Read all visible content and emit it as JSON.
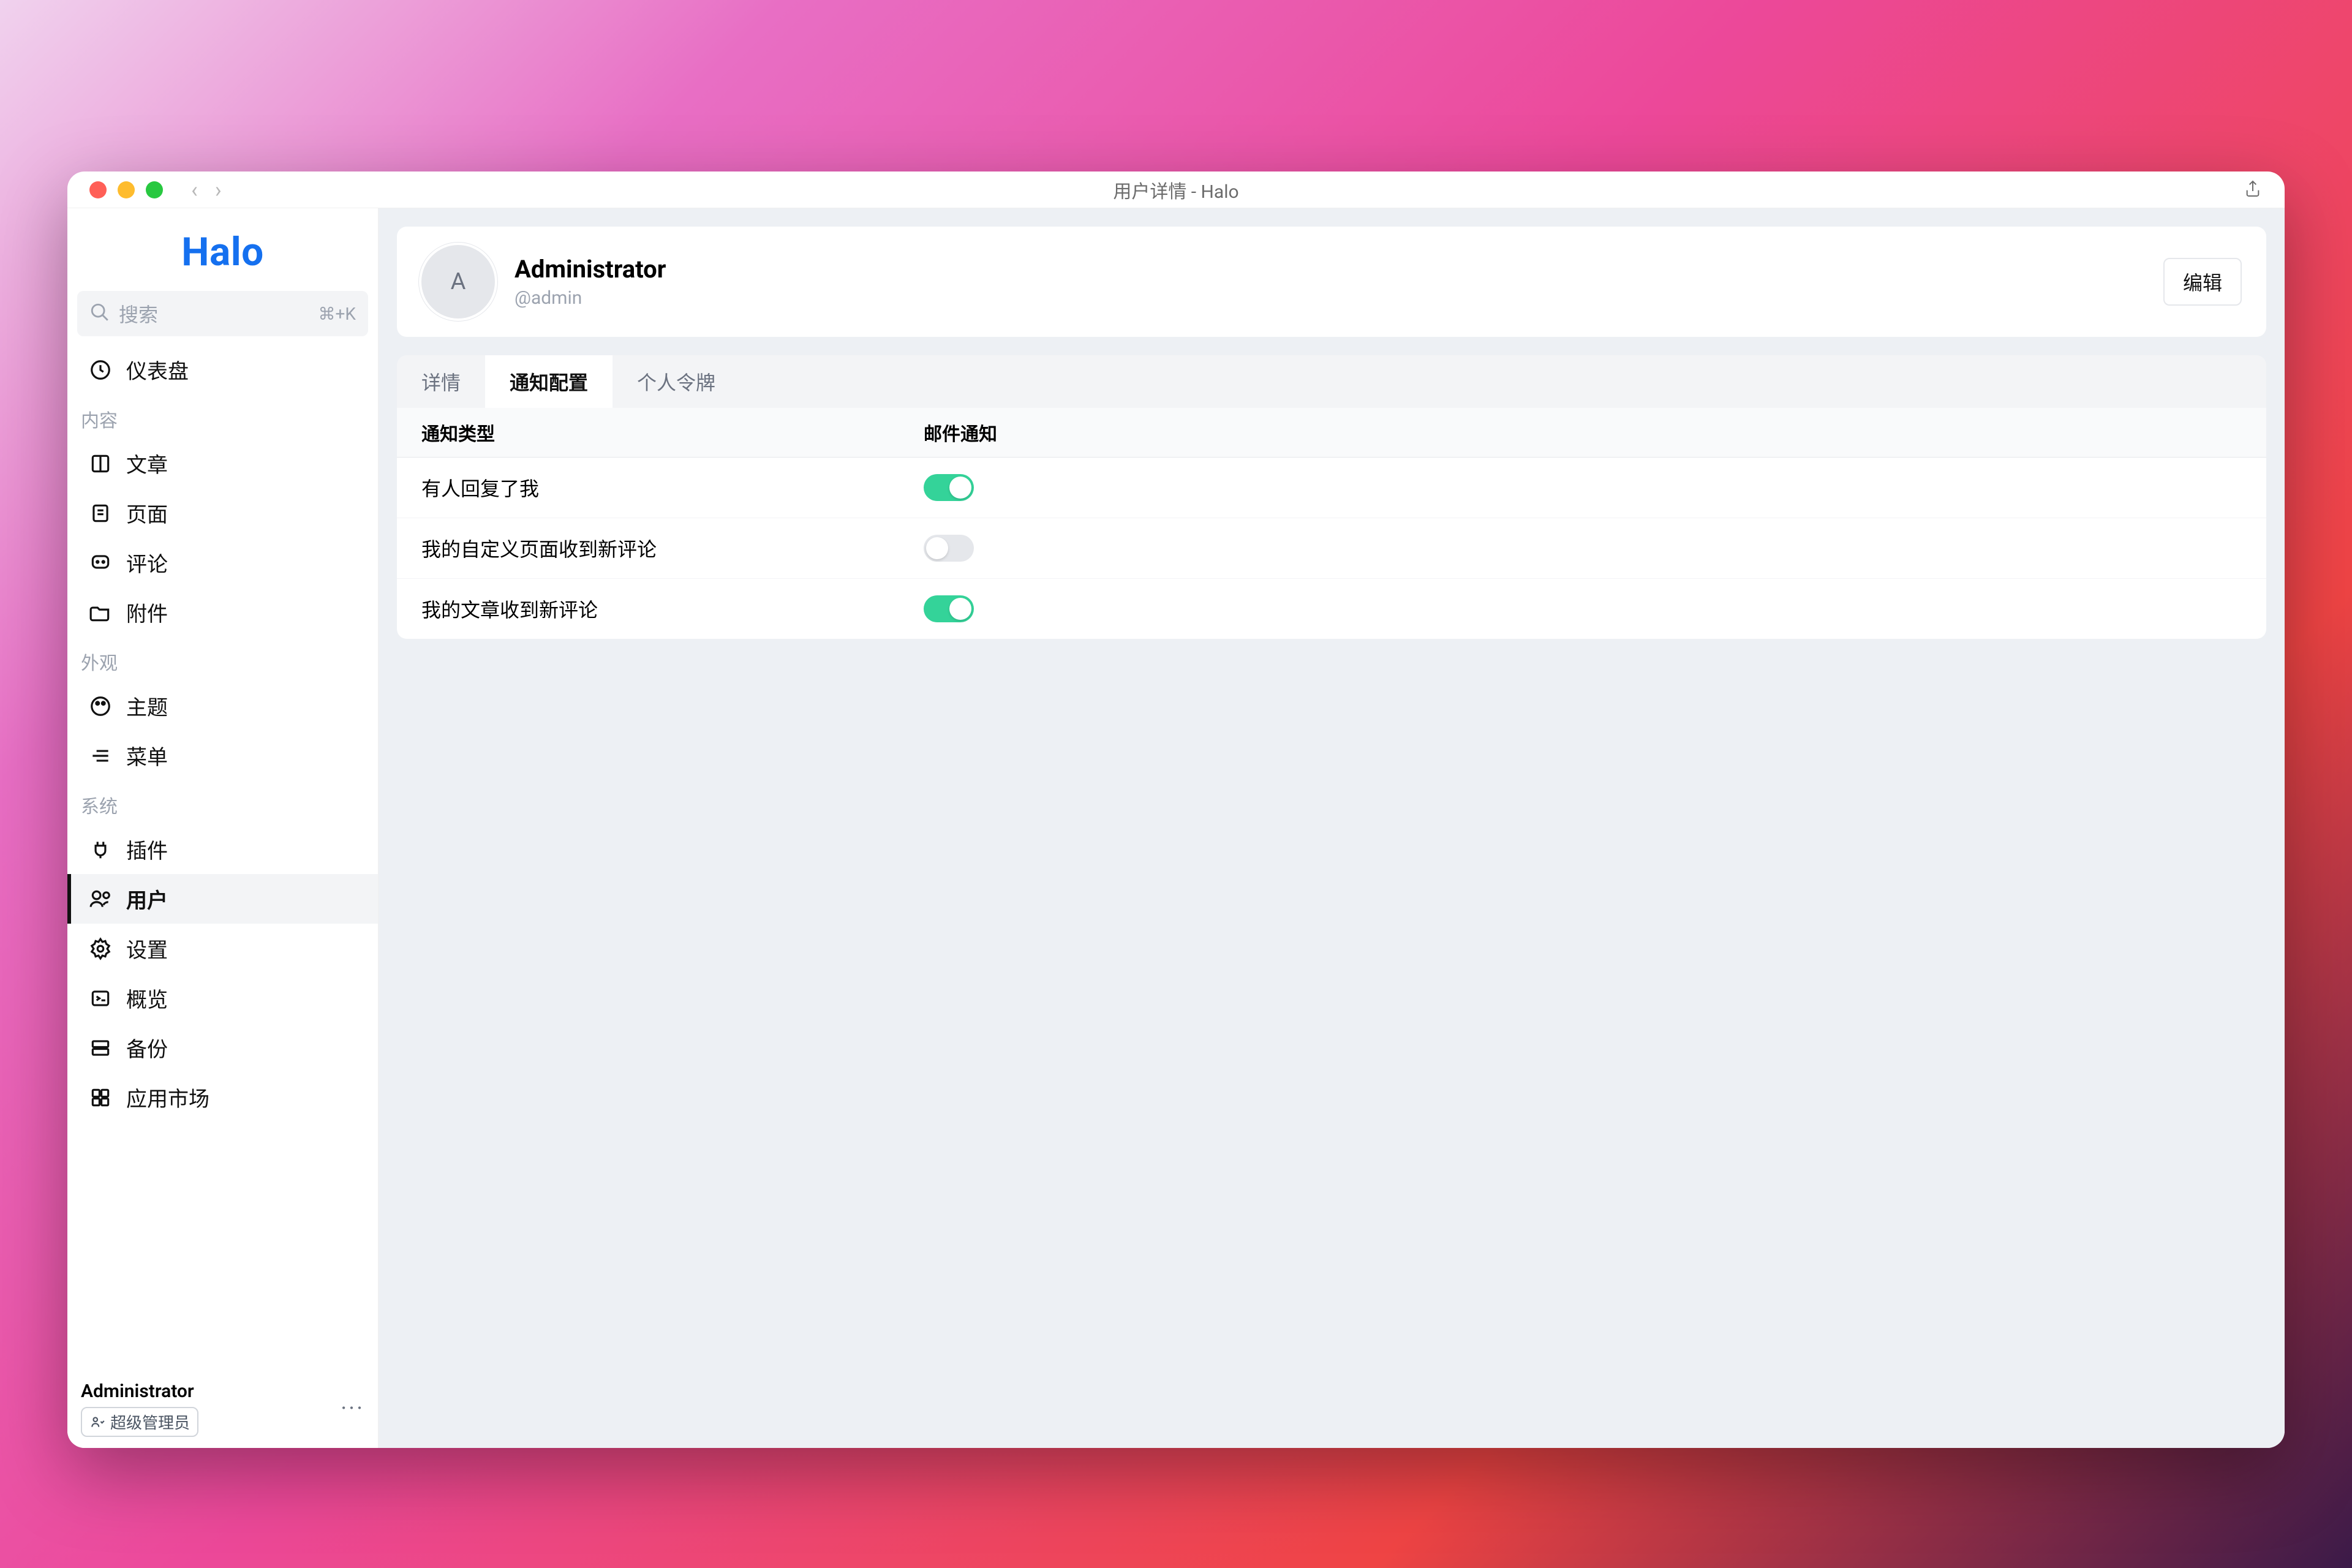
{
  "window": {
    "title": "用户详情 - Halo"
  },
  "brand": "Halo",
  "search": {
    "placeholder": "搜索",
    "shortcut": "⌘+K"
  },
  "sidebar": {
    "sections": [
      {
        "items": [
          {
            "label": "仪表盘"
          }
        ]
      },
      {
        "title": "内容",
        "items": [
          {
            "label": "文章"
          },
          {
            "label": "页面"
          },
          {
            "label": "评论"
          },
          {
            "label": "附件"
          }
        ]
      },
      {
        "title": "外观",
        "items": [
          {
            "label": "主题"
          },
          {
            "label": "菜单"
          }
        ]
      },
      {
        "title": "系统",
        "items": [
          {
            "label": "插件"
          },
          {
            "label": "用户"
          },
          {
            "label": "设置"
          },
          {
            "label": "概览"
          },
          {
            "label": "备份"
          },
          {
            "label": "应用市场"
          }
        ]
      }
    ]
  },
  "footer": {
    "name": "Administrator",
    "role": "超级管理员"
  },
  "profile": {
    "initial": "A",
    "name": "Administrator",
    "handle": "@admin",
    "edit": "编辑"
  },
  "tabs": [
    {
      "label": "详情"
    },
    {
      "label": "通知配置"
    },
    {
      "label": "个人令牌"
    }
  ],
  "table": {
    "columns": {
      "type": "通知类型",
      "email": "邮件通知"
    },
    "rows": [
      {
        "type": "有人回复了我",
        "email_on": true
      },
      {
        "type": "我的自定义页面收到新评论",
        "email_on": false
      },
      {
        "type": "我的文章收到新评论",
        "email_on": true
      }
    ]
  }
}
